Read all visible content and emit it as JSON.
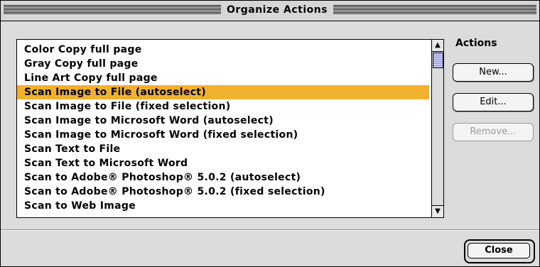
{
  "window": {
    "title": "Organize Actions"
  },
  "list": {
    "items": [
      "Color Copy full page",
      "Gray Copy full page",
      "Line Art Copy full page",
      "Scan Image to File (autoselect)",
      "Scan Image to File (fixed selection)",
      "Scan Image to Microsoft Word (autoselect)",
      "Scan Image to Microsoft Word (fixed selection)",
      "Scan Text to File",
      "Scan Text to Microsoft Word",
      "Scan to Adobe® Photoshop® 5.0.2 (autoselect)",
      "Scan to Adobe® Photoshop® 5.0.2 (fixed selection)",
      "Scan to Web Image"
    ],
    "selected_index": 3
  },
  "actions": {
    "label": "Actions",
    "new_label": "New...",
    "edit_label": "Edit...",
    "remove_label": "Remove..."
  },
  "footer": {
    "close_label": "Close"
  },
  "colors": {
    "selection": "#f2b12c",
    "scroll_thumb": "#c8c8ff"
  },
  "icons": {
    "scroll_up": "up-arrow-icon",
    "scroll_down": "down-arrow-icon"
  }
}
